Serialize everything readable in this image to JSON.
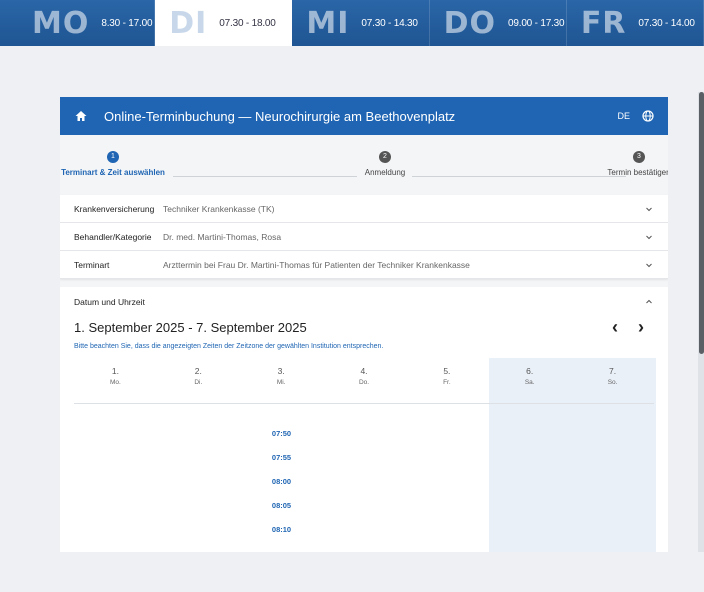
{
  "hours": [
    {
      "abbr": "MO",
      "time": "8.30 - 17.00",
      "active": false
    },
    {
      "abbr": "DI",
      "time": "07.30 - 18.00",
      "active": true
    },
    {
      "abbr": "MI",
      "time": "07.30 - 14.30",
      "active": false
    },
    {
      "abbr": "DO",
      "time": "09.00 - 17.30",
      "active": false
    },
    {
      "abbr": "FR",
      "time": "07.30 - 14.00",
      "active": false
    }
  ],
  "header": {
    "title": "Online-Terminbuchung — Neurochirurgie am Beethovenplatz",
    "lang": "DE"
  },
  "steps": [
    {
      "num": "1",
      "label": "Terminart & Zeit auswählen"
    },
    {
      "num": "2",
      "label": "Anmeldung"
    },
    {
      "num": "3",
      "label": "Termin bestätigen"
    }
  ],
  "fields": [
    {
      "key": "Krankenversicherung",
      "value": "Techniker Krankenkasse (TK)"
    },
    {
      "key": "Behandler/Kategorie",
      "value": "Dr. med. Martini-Thomas, Rosa"
    },
    {
      "key": "Terminart",
      "value": "Arzttermin bei Frau Dr. Martini-Thomas für Patienten der Techniker Krankenkasse"
    }
  ],
  "date": {
    "section_label": "Datum und Uhrzeit",
    "week_title": "1. September 2025 - 7. September 2025",
    "prev": "‹",
    "next": "›",
    "note": "Bitte beachten Sie, dass die angezeigten Zeiten der Zeitzone der gewählten Institution entsprechen.",
    "days": [
      {
        "num": "1.",
        "wd": "Mo."
      },
      {
        "num": "2.",
        "wd": "Di."
      },
      {
        "num": "3.",
        "wd": "Mi."
      },
      {
        "num": "4.",
        "wd": "Do."
      },
      {
        "num": "5.",
        "wd": "Fr."
      },
      {
        "num": "6.",
        "wd": "Sa."
      },
      {
        "num": "7.",
        "wd": "So."
      }
    ],
    "slots": [
      "07:50",
      "07:55",
      "08:00",
      "08:05",
      "08:10"
    ]
  }
}
